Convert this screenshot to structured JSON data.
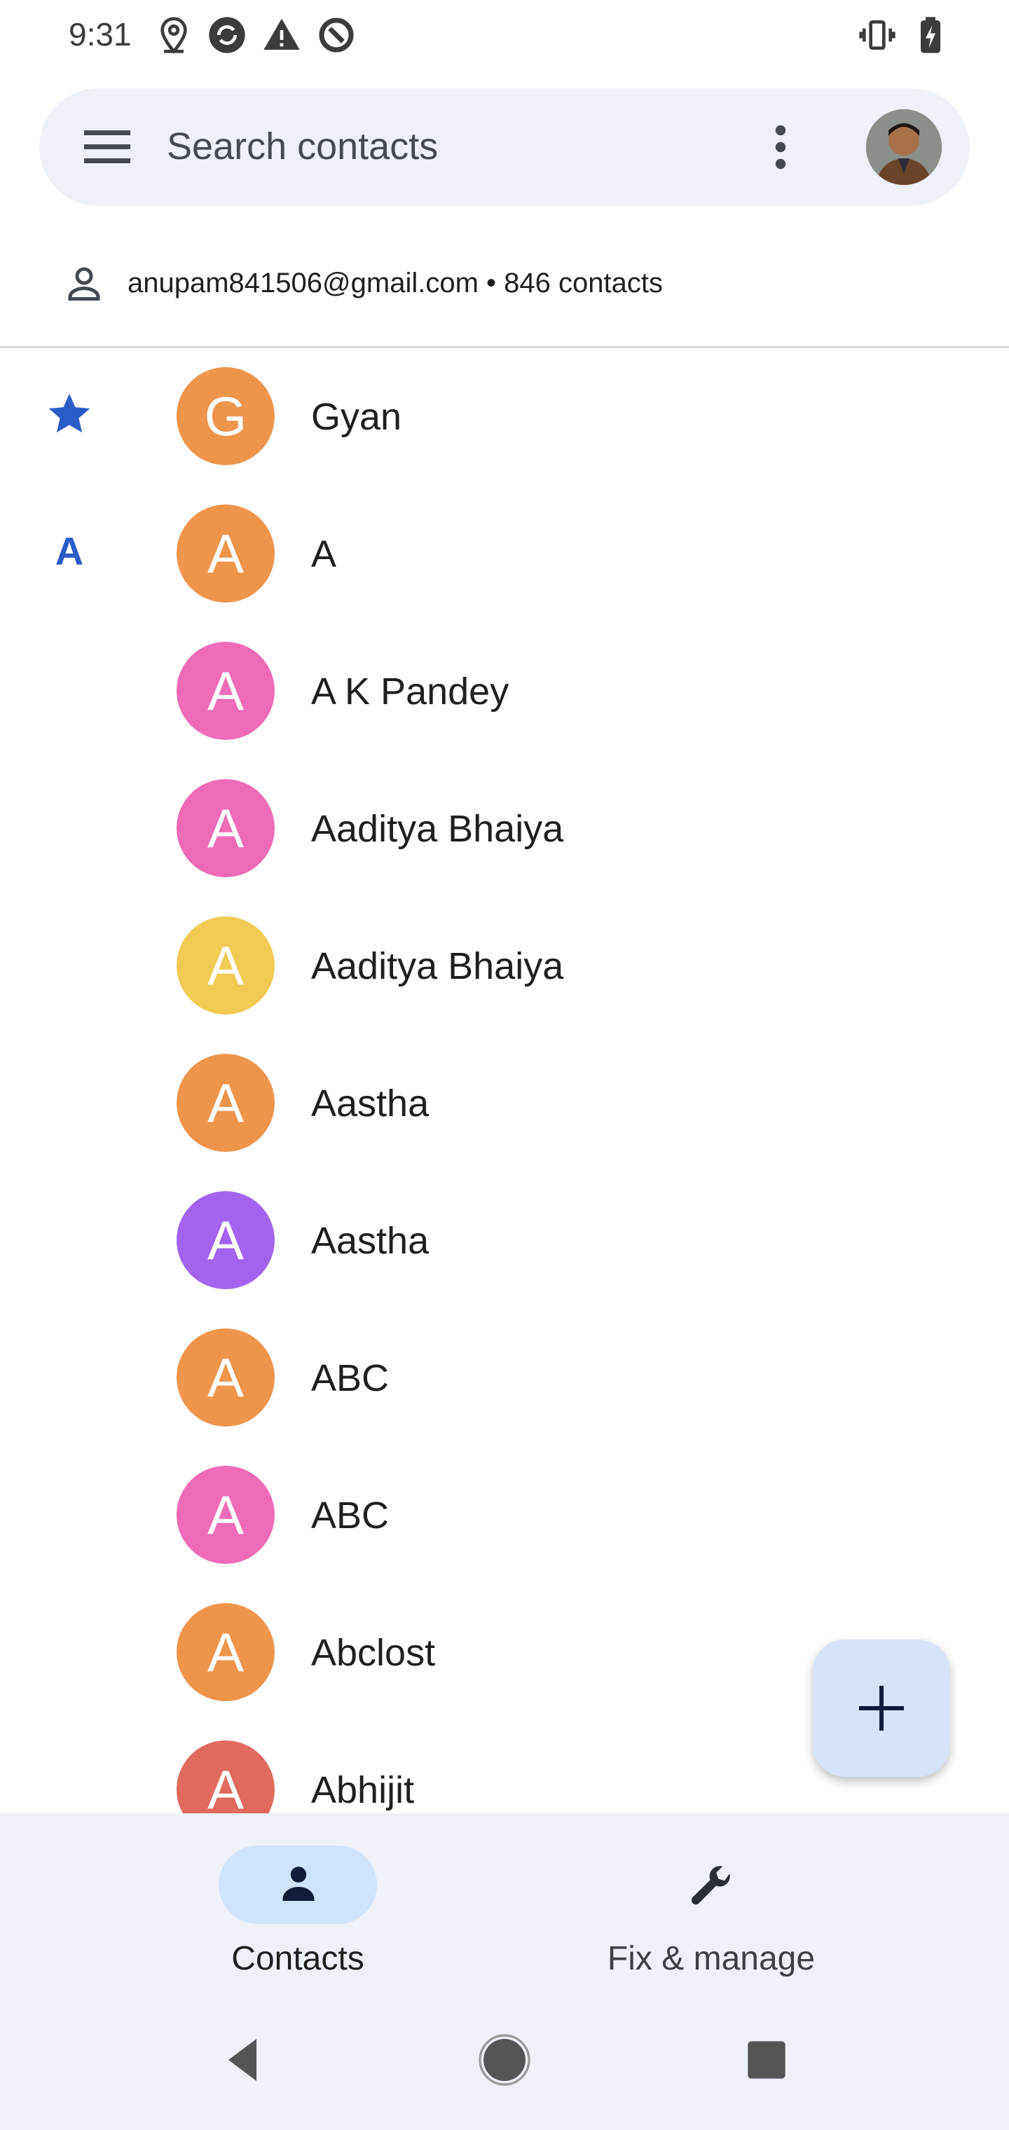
{
  "status_bar": {
    "time": "9:31",
    "icons": [
      "location-icon",
      "sync-icon",
      "warning-icon",
      "data-saver-icon",
      "vibrate-icon",
      "battery-charging-icon"
    ]
  },
  "search": {
    "placeholder": "Search contacts"
  },
  "account": {
    "summary": "anupam841506@gmail.com • 846 contacts"
  },
  "sections": {
    "favorites_icon": "star-icon",
    "a_label": "A"
  },
  "contacts": [
    {
      "initial": "G",
      "name": "Gyan",
      "color": "#ee954c"
    },
    {
      "initial": "A",
      "name": "A",
      "color": "#ee954c"
    },
    {
      "initial": "A",
      "name": "A K Pandey",
      "color": "#ee6bb8"
    },
    {
      "initial": "A",
      "name": "Aaditya Bhaiya",
      "color": "#ee6bb8"
    },
    {
      "initial": "A",
      "name": "Aaditya Bhaiya",
      "color": "#f2cb55"
    },
    {
      "initial": "A",
      "name": "Aastha",
      "color": "#ee954c"
    },
    {
      "initial": "A",
      "name": "Aastha",
      "color": "#a463ee"
    },
    {
      "initial": "A",
      "name": "ABC",
      "color": "#ee954c"
    },
    {
      "initial": "A",
      "name": "ABC",
      "color": "#ee6bb8"
    },
    {
      "initial": "A",
      "name": "Abclost",
      "color": "#ee954c"
    },
    {
      "initial": "A",
      "name": "Abhijit",
      "color": "#e06a5e"
    }
  ],
  "fab": {
    "icon": "add-icon"
  },
  "bottom_nav": {
    "contacts_label": "Contacts",
    "fix_label": "Fix & manage"
  },
  "system_nav": [
    "back-icon",
    "home-icon",
    "recents-icon"
  ]
}
